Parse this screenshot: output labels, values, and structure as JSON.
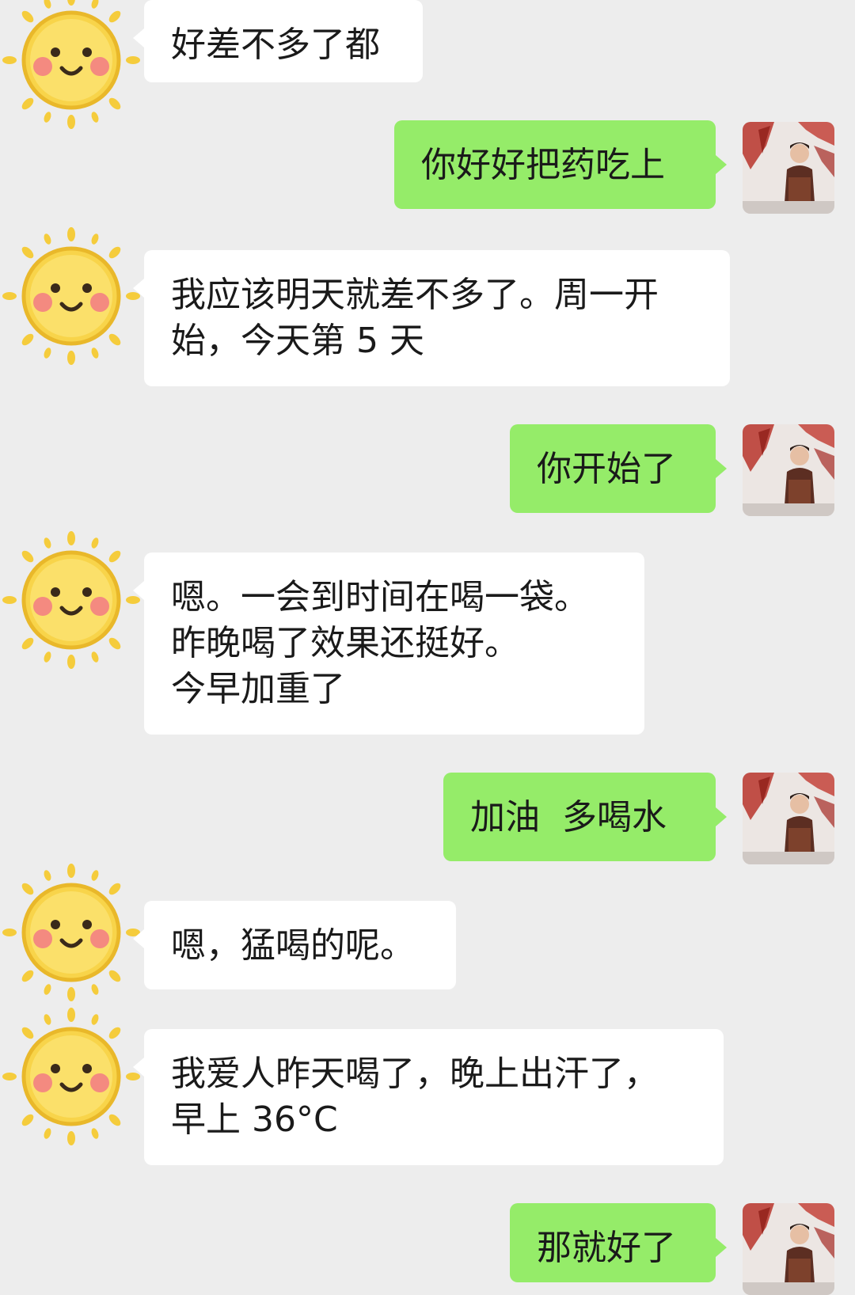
{
  "conversation": {
    "messages": [
      {
        "from": "contact",
        "avatar": "sun-emoji-avatar",
        "text": "好差不多了都"
      },
      {
        "from": "me",
        "avatar": "user-photo-avatar",
        "text": "你好好把药吃上"
      },
      {
        "from": "contact",
        "avatar": "sun-emoji-avatar",
        "text": "我应该明天就差不多了。周一开\n始，今天第 5 天"
      },
      {
        "from": "me",
        "avatar": "user-photo-avatar",
        "text": "你开始了"
      },
      {
        "from": "contact",
        "avatar": "sun-emoji-avatar",
        "text": "嗯。一会到时间在喝一袋。\n昨晚喝了效果还挺好。\n今早加重了"
      },
      {
        "from": "me",
        "avatar": "user-photo-avatar",
        "text": "加油  多喝水"
      },
      {
        "from": "contact",
        "avatar": "sun-emoji-avatar",
        "text": "嗯，猛喝的呢。"
      },
      {
        "from": "contact",
        "avatar": "sun-emoji-avatar",
        "text": "我爱人昨天喝了，晚上出汗了，\n早上 36°C"
      },
      {
        "from": "me",
        "avatar": "user-photo-avatar",
        "text": "那就好了"
      }
    ]
  },
  "colors": {
    "background": "#ededed",
    "incoming_bubble": "#ffffff",
    "outgoing_bubble": "#95ec69",
    "text": "#1a1a1a"
  }
}
